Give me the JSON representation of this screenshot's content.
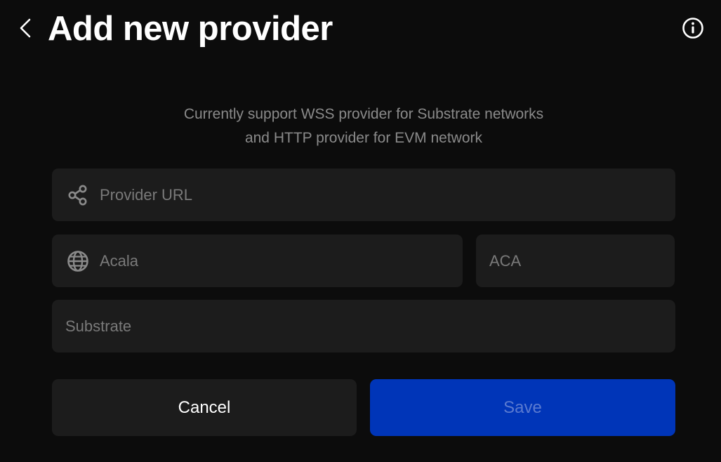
{
  "header": {
    "title": "Add new provider",
    "back_icon": "chevron-left-icon",
    "info_icon": "info-circle-icon"
  },
  "description": {
    "line1": "Currently support WSS provider for Substrate networks",
    "line2": "and HTTP provider for EVM network"
  },
  "form": {
    "provider_url": {
      "value": "",
      "placeholder": "Provider URL",
      "icon": "share-nodes-icon"
    },
    "network_name": {
      "value": "",
      "placeholder": "Acala",
      "icon": "globe-icon"
    },
    "symbol": {
      "value": "",
      "placeholder": "ACA"
    },
    "network_type": {
      "value": "",
      "placeholder": "Substrate"
    }
  },
  "actions": {
    "cancel_label": "Cancel",
    "save_label": "Save"
  },
  "colors": {
    "background": "#0c0c0c",
    "field": "#1c1c1c",
    "primary": "#0035b8",
    "primary_disabled_text": "#5a7ad0"
  }
}
